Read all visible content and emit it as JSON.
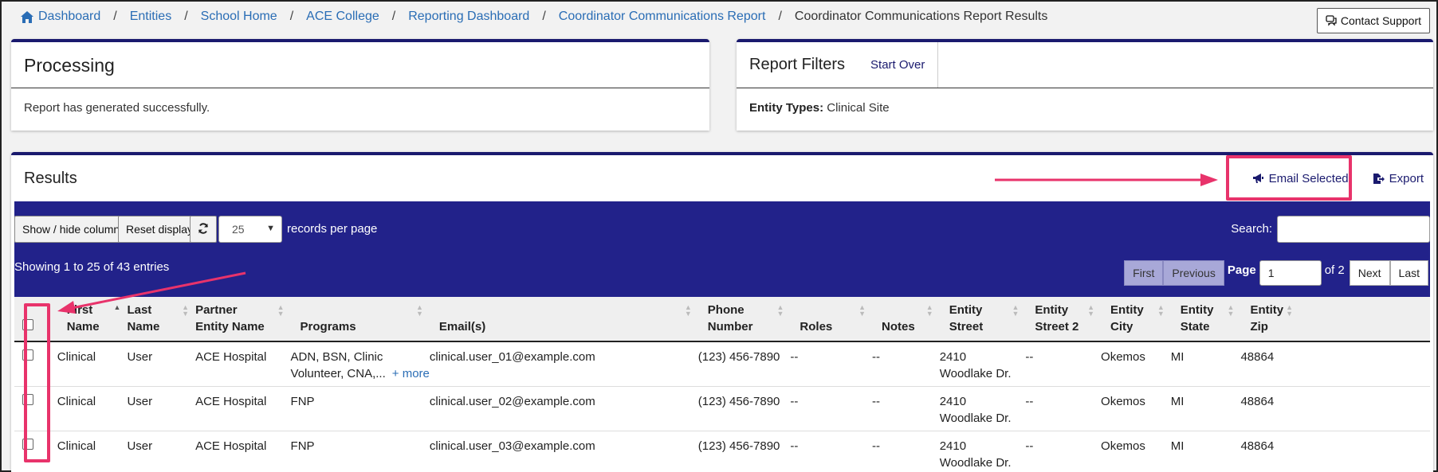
{
  "breadcrumb": {
    "items": [
      "Dashboard",
      "Entities",
      "School Home",
      "ACE College",
      "Reporting Dashboard",
      "Coordinator Communications Report"
    ],
    "current": "Coordinator Communications Report Results",
    "separator": "/"
  },
  "contact_support": "Contact Support",
  "processing": {
    "title": "Processing",
    "message": "Report has generated successfully."
  },
  "filters": {
    "title": "Report Filters",
    "start_over": "Start Over",
    "entity_types_label": "Entity Types:",
    "entity_types_value": "Clinical Site"
  },
  "results": {
    "title": "Results",
    "email_selected": "Email Selected",
    "export": "Export",
    "show_hide_columns": "Show / hide columns",
    "reset_display": "Reset display",
    "page_length": "25",
    "records_per_page": "records per page",
    "search_label": "Search:",
    "info": "Showing 1 to 25 of 43 entries",
    "pager": {
      "first": "First",
      "previous": "Previous",
      "page_label": "Page",
      "page_value": "1",
      "of_label": "of 2",
      "next": "Next",
      "last": "Last"
    },
    "columns": [
      {
        "line1": "First",
        "line2": "Name"
      },
      {
        "line1": "Last",
        "line2": "Name"
      },
      {
        "line1": "Partner",
        "line2": "Entity Name"
      },
      {
        "line1": "",
        "line2": "Programs"
      },
      {
        "line1": "",
        "line2": "Email(s)"
      },
      {
        "line1": "Phone",
        "line2": "Number"
      },
      {
        "line1": "",
        "line2": "Roles"
      },
      {
        "line1": "",
        "line2": "Notes"
      },
      {
        "line1": "Entity",
        "line2": "Street"
      },
      {
        "line1": "Entity",
        "line2": "Street 2"
      },
      {
        "line1": "Entity",
        "line2": "City"
      },
      {
        "line1": "Entity",
        "line2": "State"
      },
      {
        "line1": "Entity",
        "line2": "Zip"
      }
    ],
    "rows": [
      {
        "first": "Clinical",
        "last": "User",
        "partner": "ACE Hospital",
        "programs_1": "ADN, BSN, Clinic",
        "programs_2": "Volunteer, CNA,...",
        "more": "+ more",
        "email": "clinical.user_01@example.com",
        "phone": "(123) 456-7890",
        "roles": "--",
        "notes": "--",
        "street_1": "2410",
        "street_2": "Woodlake Dr.",
        "street2": "--",
        "city": "Okemos",
        "state": "MI",
        "zip": "48864"
      },
      {
        "first": "Clinical",
        "last": "User",
        "partner": "ACE Hospital",
        "programs_1": "FNP",
        "programs_2": "",
        "more": "",
        "email": "clinical.user_02@example.com",
        "phone": "(123) 456-7890",
        "roles": "--",
        "notes": "--",
        "street_1": "2410",
        "street_2": "Woodlake Dr.",
        "street2": "--",
        "city": "Okemos",
        "state": "MI",
        "zip": "48864"
      },
      {
        "first": "Clinical",
        "last": "User",
        "partner": "ACE Hospital",
        "programs_1": "FNP",
        "programs_2": "",
        "more": "",
        "email": "clinical.user_03@example.com",
        "phone": "(123) 456-7890",
        "roles": "--",
        "notes": "--",
        "street_1": "2410",
        "street_2": "Woodlake Dr.",
        "street2": "--",
        "city": "Okemos",
        "state": "MI",
        "zip": "48864"
      }
    ]
  },
  "colors": {
    "navy": "#22228a",
    "card_border": "#1a1a6e",
    "link": "#2a6db5",
    "annotation": "#e8336b"
  },
  "icons": [
    "home-icon",
    "chat-icon",
    "megaphone-icon",
    "export-icon",
    "refresh-icon",
    "chevron-down-icon",
    "sort-icon"
  ]
}
